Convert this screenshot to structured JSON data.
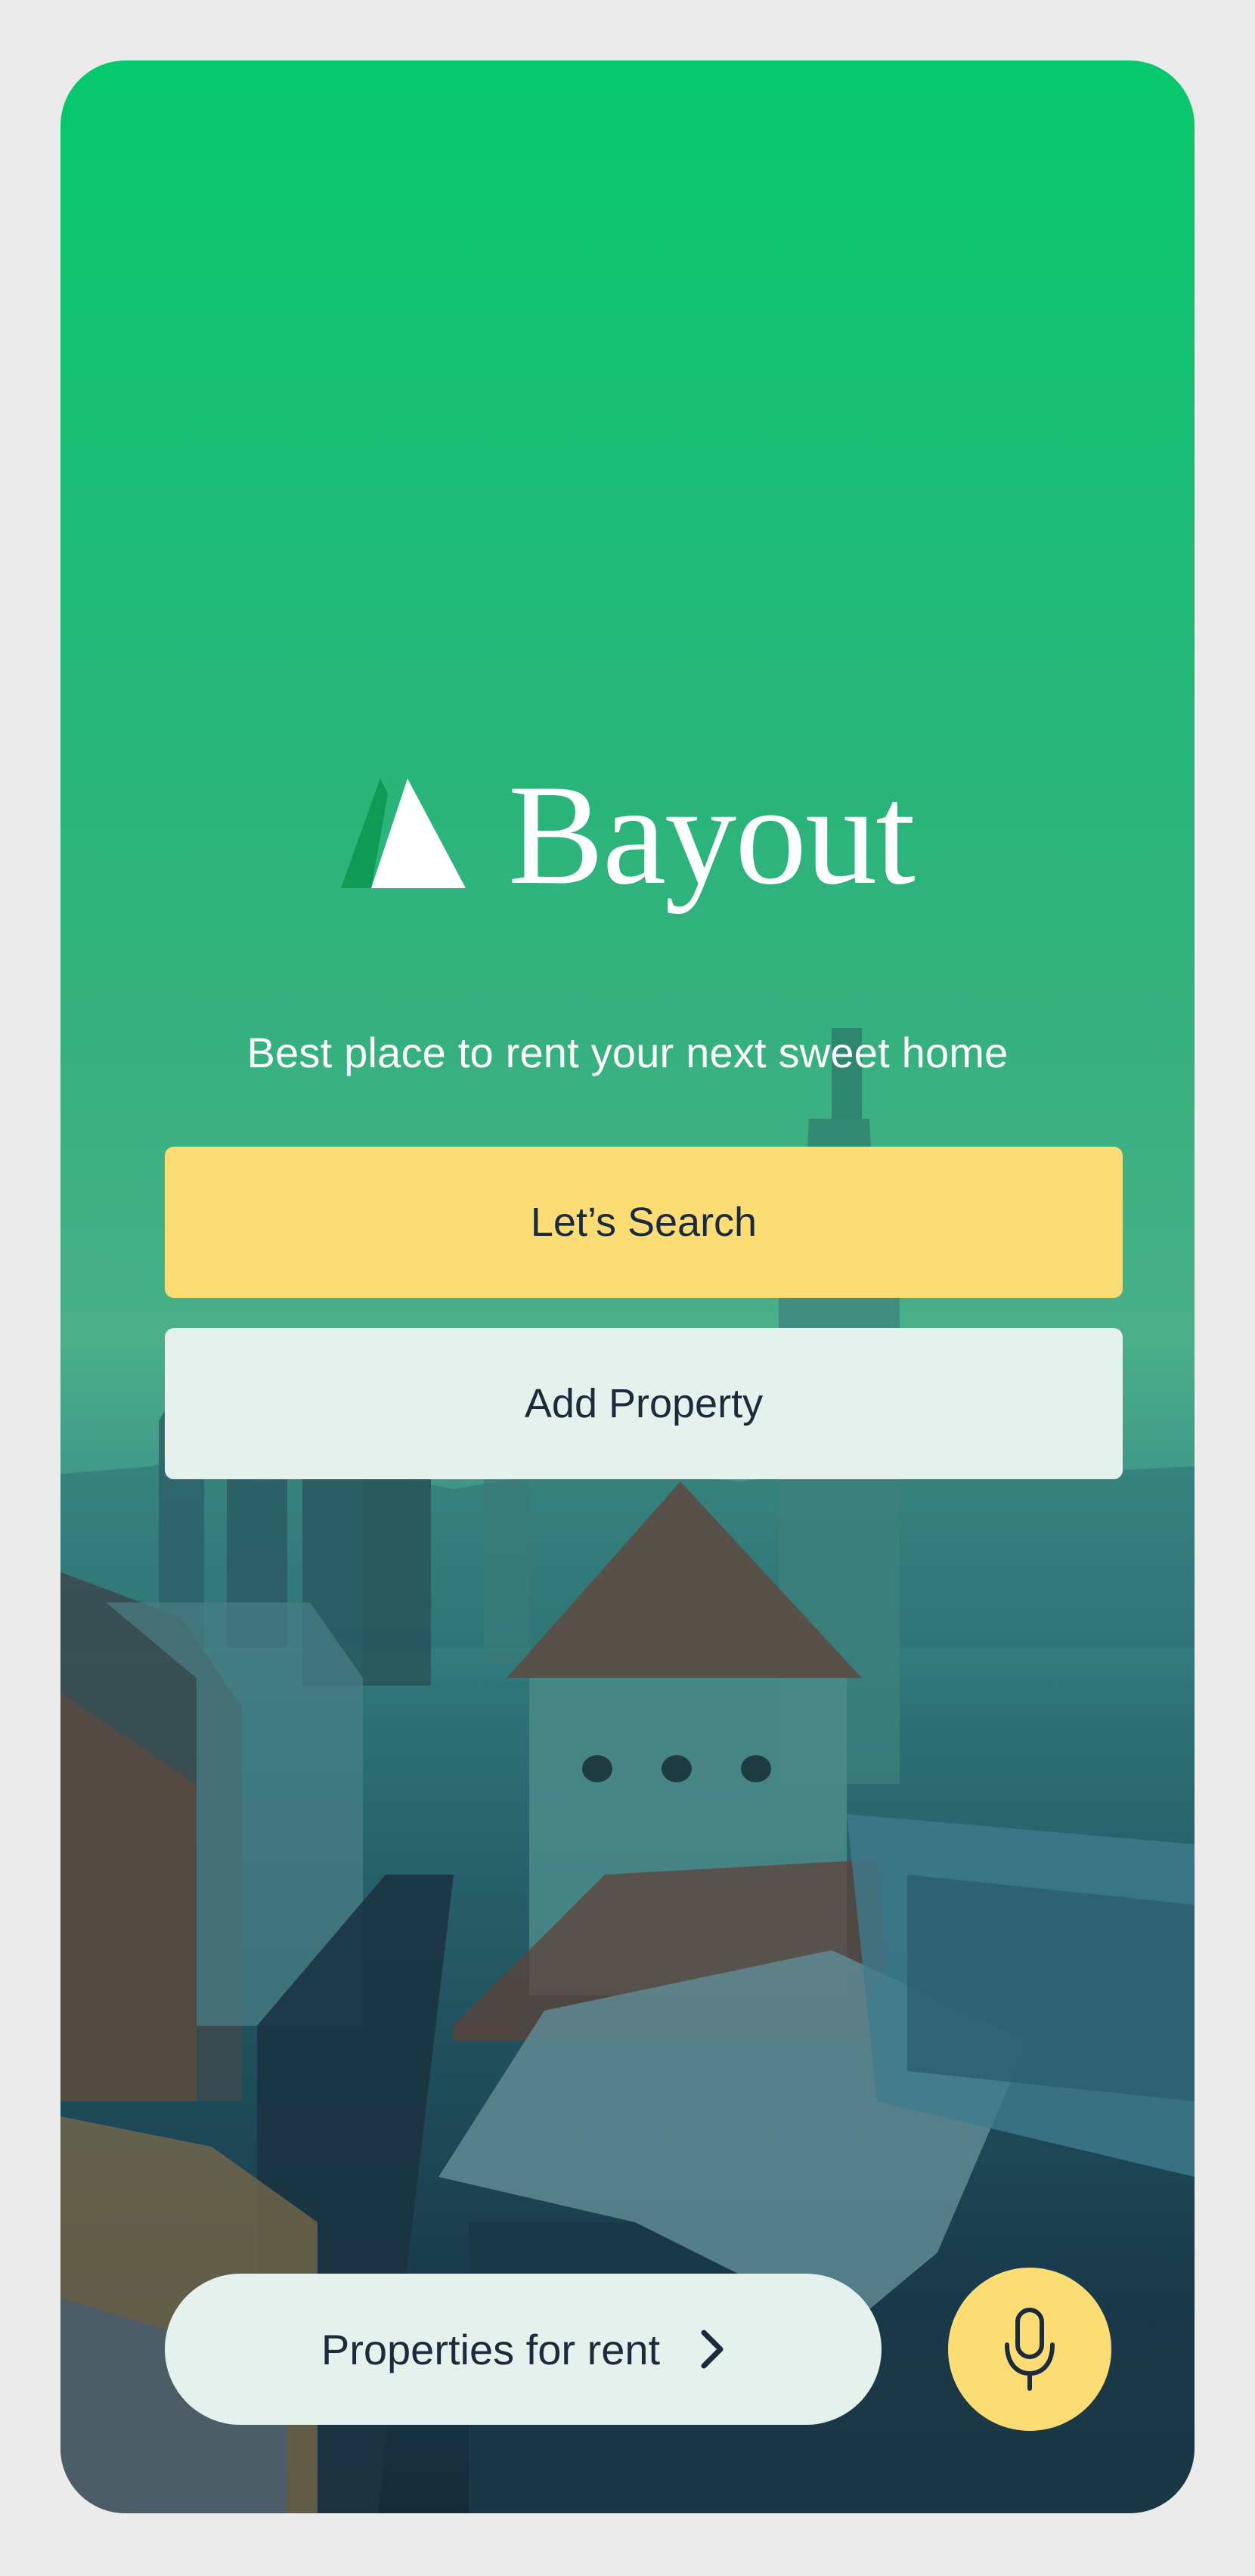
{
  "app": {
    "name": "Bayout",
    "tagline": "Best place to rent your next sweet home"
  },
  "actions": {
    "search_label": "Let’s Search",
    "add_property_label": "Add Property"
  },
  "bottom_bar": {
    "properties_label": "Properties for rent"
  },
  "icons": {
    "logo": "bayout-logo-icon",
    "chevron": "chevron-right-icon",
    "voice": "microphone-icon"
  },
  "colors": {
    "brand_green": "#06c86c",
    "accent_yellow": "#fcdc75",
    "light_button": "#e4f1ec",
    "text_dark": "#1b2a3c"
  }
}
